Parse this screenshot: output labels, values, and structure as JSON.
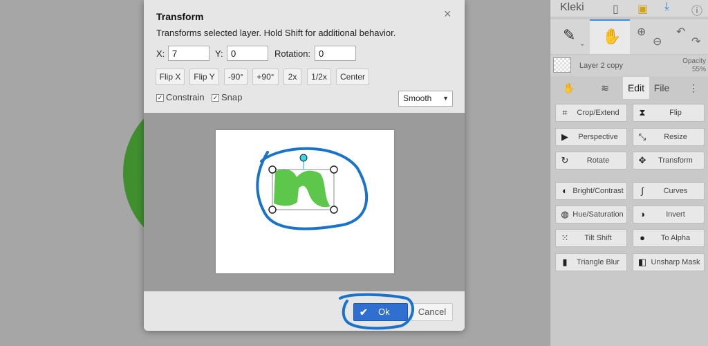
{
  "dialog": {
    "title": "Transform",
    "close_glyph": "×",
    "description": "Transforms selected layer. Hold Shift for additional behavior.",
    "x_label": "X:",
    "x_value": "7",
    "y_label": "Y:",
    "y_value": "0",
    "rotation_label": "Rotation:",
    "rotation_value": "0",
    "buttons": [
      "Flip X",
      "Flip Y",
      "-90°",
      "+90°",
      "2x",
      "1/2x",
      "Center"
    ],
    "constrain_label": "Constrain",
    "snap_label": "Snap",
    "check_glyph": "✓",
    "interpolation": "Smooth",
    "select_arrow": "▼",
    "ok_label": "Ok",
    "ok_icon": "✔",
    "cancel_label": "Cancel"
  },
  "sidebar": {
    "app_name": "Kleki",
    "layer_name": "Layer 2 copy",
    "opacity_label": "Opacity",
    "opacity_value": "55%",
    "tab_edit": "Edit",
    "tab_file": "File",
    "filters": [
      {
        "label": "Crop/Extend",
        "icon": "crop-icon",
        "glyph": "⌗"
      },
      {
        "label": "Flip",
        "icon": "flip-icon",
        "glyph": "⧗"
      },
      {
        "label": "Perspective",
        "icon": "perspective-icon",
        "glyph": "▶"
      },
      {
        "label": "Resize",
        "icon": "resize-icon",
        "glyph": "⤡"
      },
      {
        "label": "Rotate",
        "icon": "rotate-icon",
        "glyph": "↻"
      },
      {
        "label": "Transform",
        "icon": "transform-icon",
        "glyph": "✥"
      },
      {
        "label": "Bright/Contrast",
        "icon": "brightness-icon",
        "glyph": "◐"
      },
      {
        "label": "Curves",
        "icon": "curves-icon",
        "glyph": "∫"
      },
      {
        "label": "Hue/Saturation",
        "icon": "hue-icon",
        "glyph": "◍"
      },
      {
        "label": "Invert",
        "icon": "invert-icon",
        "glyph": "◑"
      },
      {
        "label": "Tilt Shift",
        "icon": "tilt-shift-icon",
        "glyph": "⁙"
      },
      {
        "label": "To Alpha",
        "icon": "to-alpha-icon",
        "glyph": "●"
      },
      {
        "label": "Triangle Blur",
        "icon": "triangle-blur-icon",
        "glyph": "▮"
      },
      {
        "label": "Unsharp Mask",
        "icon": "unsharp-mask-icon",
        "glyph": "◧"
      }
    ]
  },
  "colors": {
    "accent": "#2f6fd0",
    "annotation": "#1a73c9",
    "shape": "#5cc74a",
    "handle": "#39d5e6"
  }
}
